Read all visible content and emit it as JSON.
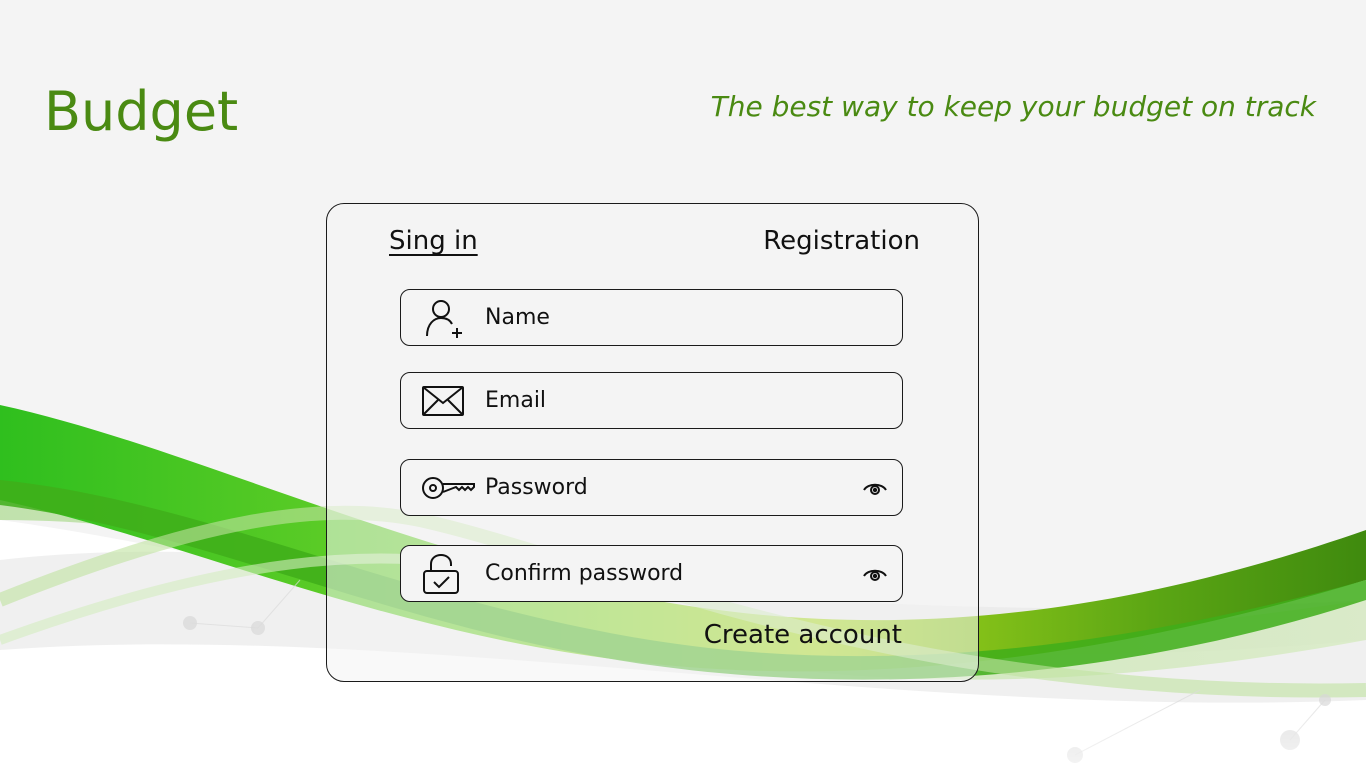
{
  "header": {
    "brand": "Budget",
    "tagline": "The best way to keep your budget on track"
  },
  "auth_card": {
    "tabs": {
      "signin_label": "Sing in",
      "registration_label": "Registration"
    },
    "fields": {
      "name_placeholder": "Name",
      "email_placeholder": "Email",
      "password_placeholder": "Password",
      "confirm_password_placeholder": "Confirm password"
    },
    "create_account_label": "Create account"
  },
  "icons": {
    "name": "add-user-icon",
    "email": "envelope-icon",
    "password": "key-icon",
    "confirm_password": "unlock-check-icon",
    "toggle_visibility": "eye-icon"
  },
  "colors": {
    "brand_green": "#4a8a12",
    "background": "#f4f4f4",
    "wave_light_green": "#7ed321",
    "wave_dark_green": "#3f8a0e"
  }
}
